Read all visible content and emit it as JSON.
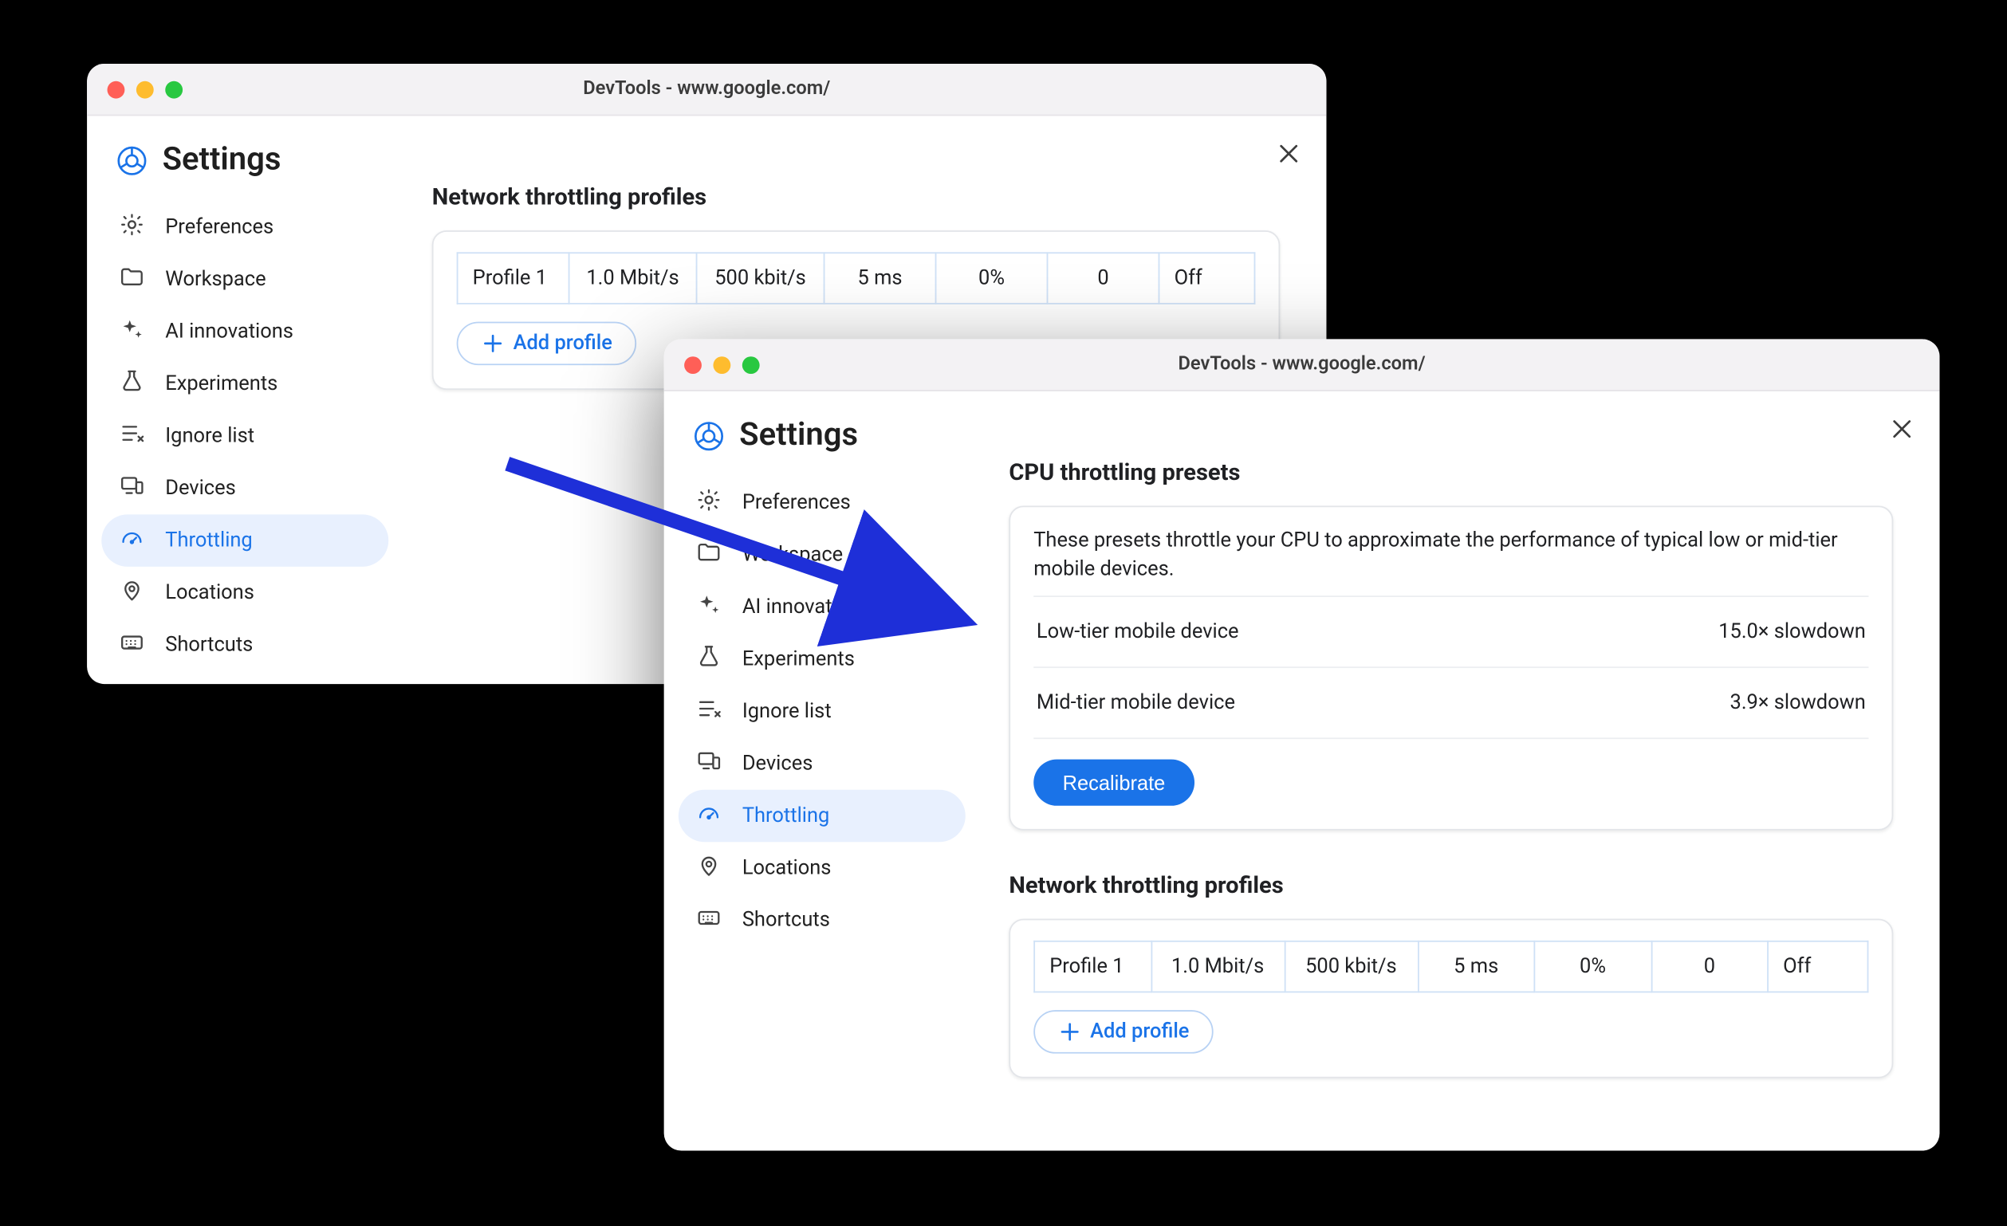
{
  "window_back": {
    "title": "DevTools - www.google.com/",
    "settings_title": "Settings",
    "sidebar": [
      {
        "icon": "gear",
        "label": "Preferences"
      },
      {
        "icon": "folder",
        "label": "Workspace"
      },
      {
        "icon": "sparkle",
        "label": "AI innovations"
      },
      {
        "icon": "flask",
        "label": "Experiments"
      },
      {
        "icon": "ignore",
        "label": "Ignore list"
      },
      {
        "icon": "devices",
        "label": "Devices"
      },
      {
        "icon": "gauge",
        "label": "Throttling",
        "active": true
      },
      {
        "icon": "pin",
        "label": "Locations"
      },
      {
        "icon": "keyboard",
        "label": "Shortcuts"
      }
    ],
    "network_title": "Network throttling profiles",
    "profile": {
      "name": "Profile 1",
      "down": "1.0 Mbit/s",
      "up": "500 kbit/s",
      "latency": "5 ms",
      "loss": "0%",
      "queue": "0",
      "state": "Off"
    },
    "add_profile_label": "Add profile"
  },
  "window_front": {
    "title": "DevTools - www.google.com/",
    "settings_title": "Settings",
    "sidebar": [
      {
        "icon": "gear",
        "label": "Preferences"
      },
      {
        "icon": "folder",
        "label": "Workspace"
      },
      {
        "icon": "sparkle",
        "label": "AI innovations"
      },
      {
        "icon": "flask",
        "label": "Experiments"
      },
      {
        "icon": "ignore",
        "label": "Ignore list"
      },
      {
        "icon": "devices",
        "label": "Devices"
      },
      {
        "icon": "gauge",
        "label": "Throttling",
        "active": true
      },
      {
        "icon": "pin",
        "label": "Locations"
      },
      {
        "icon": "keyboard",
        "label": "Shortcuts"
      }
    ],
    "cpu_title": "CPU throttling presets",
    "cpu_desc": "These presets throttle your CPU to approximate the performance of typical low or mid-tier mobile devices.",
    "presets": [
      {
        "name": "Low-tier mobile device",
        "value": "15.0× slowdown"
      },
      {
        "name": "Mid-tier mobile device",
        "value": "3.9× slowdown"
      }
    ],
    "recalibrate_label": "Recalibrate",
    "network_title": "Network throttling profiles",
    "profile": {
      "name": "Profile 1",
      "down": "1.0 Mbit/s",
      "up": "500 kbit/s",
      "latency": "5 ms",
      "loss": "0%",
      "queue": "0",
      "state": "Off"
    },
    "add_profile_label": "Add profile"
  }
}
